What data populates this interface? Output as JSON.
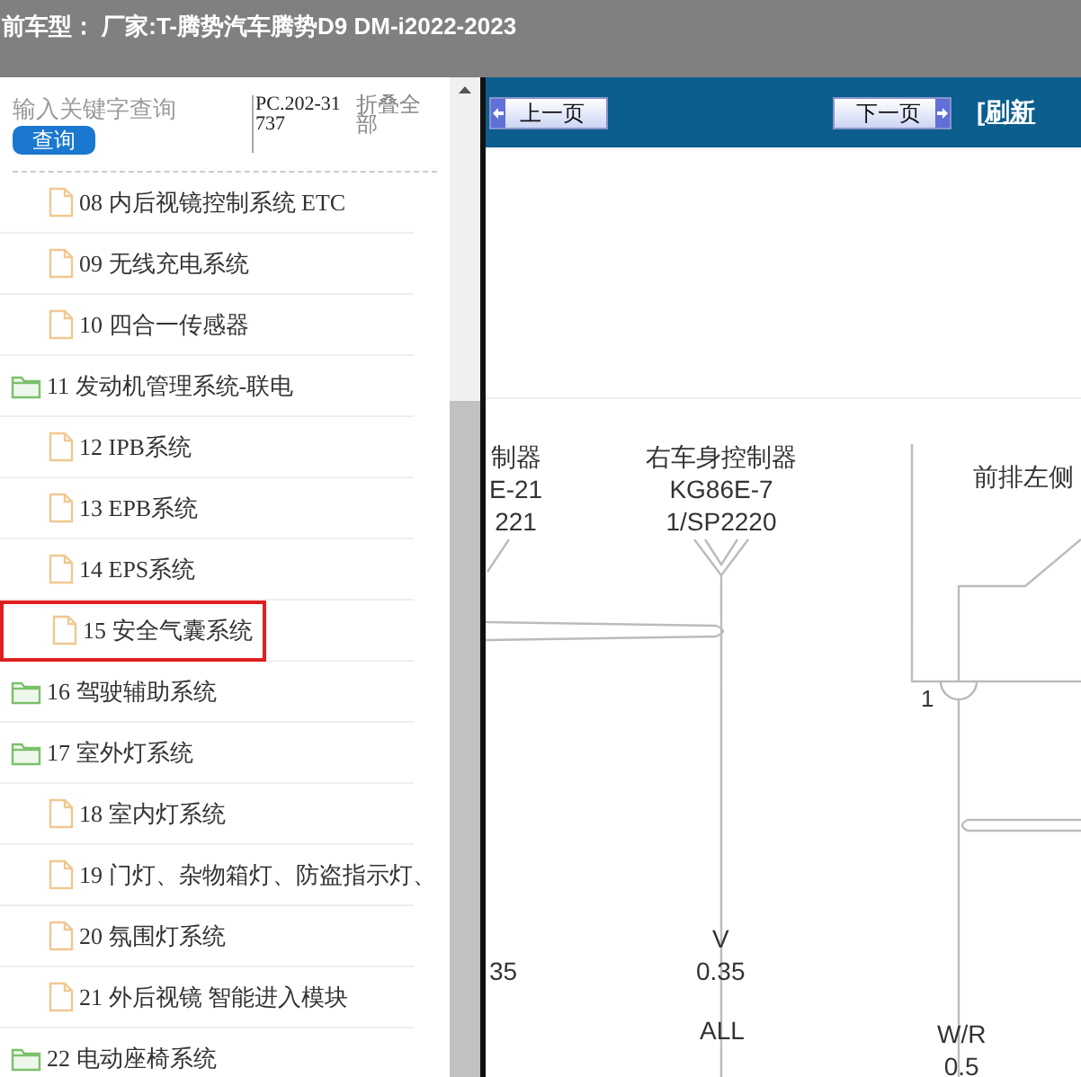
{
  "title_bar": {
    "title": "前车型： 厂家:T-腾势汽车腾势D9 DM-i2022-2023"
  },
  "sidebar": {
    "search": {
      "placeholder": "输入关键字查询",
      "button": "查询"
    },
    "code": "PC.202-31737",
    "collapse_all": "折叠全部",
    "items": [
      {
        "kind": "file",
        "label": "08 内后视镜控制系统 ETC",
        "highlighted": false
      },
      {
        "kind": "file",
        "label": "09 无线充电系统",
        "highlighted": false
      },
      {
        "kind": "file",
        "label": "10 四合一传感器",
        "highlighted": false
      },
      {
        "kind": "folder",
        "label": "11 发动机管理系统-联电",
        "highlighted": false
      },
      {
        "kind": "file",
        "label": "12 IPB系统",
        "highlighted": false
      },
      {
        "kind": "file",
        "label": "13 EPB系统",
        "highlighted": false
      },
      {
        "kind": "file",
        "label": "14 EPS系统",
        "highlighted": false
      },
      {
        "kind": "file",
        "label": "15 安全气囊系统",
        "highlighted": true
      },
      {
        "kind": "folder",
        "label": "16 驾驶辅助系统",
        "highlighted": false
      },
      {
        "kind": "folder",
        "label": "17 室外灯系统",
        "highlighted": false
      },
      {
        "kind": "file",
        "label": "18 室内灯系统",
        "highlighted": false
      },
      {
        "kind": "file",
        "label": "19 门灯、杂物箱灯、防盗指示灯、",
        "highlighted": false
      },
      {
        "kind": "file",
        "label": "20 氛围灯系统",
        "highlighted": false
      },
      {
        "kind": "file",
        "label": "21 外后视镜 智能进入模块",
        "highlighted": false
      },
      {
        "kind": "folder",
        "label": "22 电动座椅系统",
        "highlighted": false
      }
    ]
  },
  "toolbar": {
    "prev_button": "上一页",
    "next_button": "下一页",
    "refresh_link": "[刷新"
  },
  "diagram": {
    "left_connector": [
      "制器",
      "E-21",
      "221"
    ],
    "right_connector": [
      "右车身控制器",
      "KG86E-7",
      "1/SP2220"
    ],
    "module": {
      "title": "前排左侧",
      "pin": "1"
    },
    "wire_labels": [
      {
        "kind": "left",
        "lines": [
          "35"
        ]
      },
      {
        "kind": "middle",
        "lines": [
          "V",
          "0.35"
        ]
      },
      {
        "kind": "middle_low",
        "lines": [
          "ALL"
        ]
      },
      {
        "kind": "right",
        "lines": [
          "W/R",
          "0.5"
        ]
      }
    ]
  }
}
